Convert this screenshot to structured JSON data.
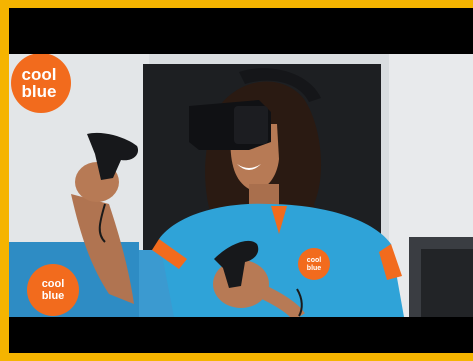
{
  "scene": {
    "description_icon": "vr-headset-user-photo",
    "colors": {
      "frame": "#f5b400",
      "letterbox": "#000000",
      "brand": "#f26b1d",
      "shirt": "#2fa3d8",
      "wall": "#d9dde0"
    }
  },
  "logo": {
    "line1": "cool",
    "line2": "blue"
  }
}
